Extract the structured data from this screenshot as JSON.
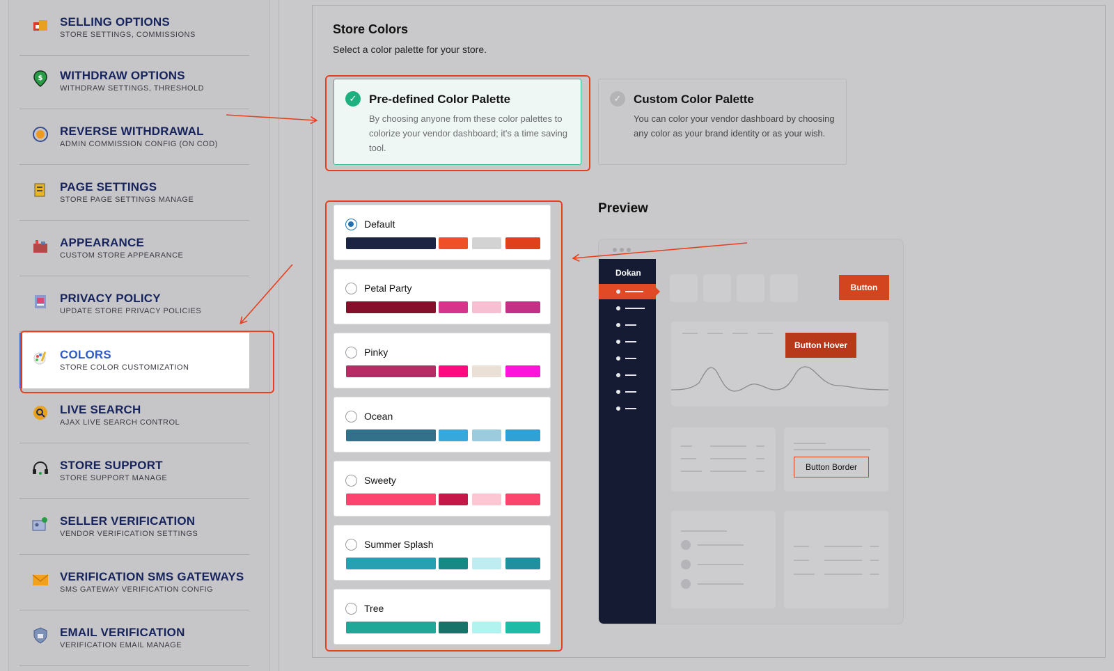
{
  "sidebar": {
    "items": [
      {
        "title": "SELLING OPTIONS",
        "sub": "STORE SETTINGS, COMMISSIONS",
        "icon": "store-icon"
      },
      {
        "title": "WITHDRAW OPTIONS",
        "sub": "WITHDRAW SETTINGS, THRESHOLD",
        "icon": "dollar-pin-icon"
      },
      {
        "title": "REVERSE WITHDRAWAL",
        "sub": "ADMIN COMMISSION CONFIG (ON COD)",
        "icon": "reverse-coin-icon"
      },
      {
        "title": "PAGE SETTINGS",
        "sub": "STORE PAGE SETTINGS MANAGE",
        "icon": "page-icon"
      },
      {
        "title": "APPEARANCE",
        "sub": "CUSTOM STORE APPEARANCE",
        "icon": "appearance-icon"
      },
      {
        "title": "PRIVACY POLICY",
        "sub": "UPDATE STORE PRIVACY POLICIES",
        "icon": "privacy-icon"
      },
      {
        "title": "COLORS",
        "sub": "STORE COLOR CUSTOMIZATION",
        "icon": "palette-icon"
      },
      {
        "title": "LIVE SEARCH",
        "sub": "AJAX LIVE SEARCH CONTROL",
        "icon": "search-icon"
      },
      {
        "title": "STORE SUPPORT",
        "sub": "STORE SUPPORT MANAGE",
        "icon": "headset-icon"
      },
      {
        "title": "SELLER VERIFICATION",
        "sub": "VENDOR VERIFICATION SETTINGS",
        "icon": "id-card-icon"
      },
      {
        "title": "VERIFICATION SMS GATEWAYS",
        "sub": "SMS GATEWAY VERIFICATION CONFIG",
        "icon": "envelope-icon"
      },
      {
        "title": "EMAIL VERIFICATION",
        "sub": "VERIFICATION EMAIL MANAGE",
        "icon": "shield-icon"
      }
    ]
  },
  "store_colors": {
    "title": "Store Colors",
    "subtitle": "Select a color palette for your store."
  },
  "palette_types": {
    "predefined": {
      "title": "Pre-defined Color Palette",
      "desc": "By choosing anyone from these color palettes to colorize your vendor dashboard; it's a time saving tool."
    },
    "custom": {
      "title": "Custom Color Palette",
      "desc": "You can color your vendor dashboard by choosing any color as your brand identity or as your wish."
    }
  },
  "palettes": [
    {
      "name": "Default",
      "selected": true,
      "colors": [
        "#1b2543",
        "#f05025",
        "#d3d3d3",
        "#e0411b"
      ]
    },
    {
      "name": "Petal Party",
      "selected": false,
      "colors": [
        "#85102b",
        "#d5358b",
        "#f7c0d2",
        "#c23185"
      ]
    },
    {
      "name": "Pinky",
      "selected": false,
      "colors": [
        "#b72c65",
        "#fc0a7f",
        "#ebe0d6",
        "#fb15dc"
      ]
    },
    {
      "name": "Ocean",
      "selected": false,
      "colors": [
        "#33708a",
        "#37a8dc",
        "#9ccbde",
        "#2fa1d5"
      ]
    },
    {
      "name": "Sweety",
      "selected": false,
      "colors": [
        "#fc446f",
        "#c51848",
        "#fcc7d2",
        "#fc456d"
      ]
    },
    {
      "name": "Summer Splash",
      "selected": false,
      "colors": [
        "#27a0b2",
        "#178985",
        "#bfecf1",
        "#21909e"
      ]
    },
    {
      "name": "Tree",
      "selected": false,
      "colors": [
        "#1fa798",
        "#187369",
        "#b3f3ef",
        "#1ebca7"
      ]
    }
  ],
  "preview": {
    "title": "Preview",
    "brand": "Dokan",
    "button": "Button",
    "button_hover": "Button Hover",
    "button_border": "Button Border"
  },
  "colors": {
    "accent": "#e14a24",
    "highlight": "#e8401f",
    "check": "#1fb07f",
    "active_bar": "#2962d9"
  }
}
